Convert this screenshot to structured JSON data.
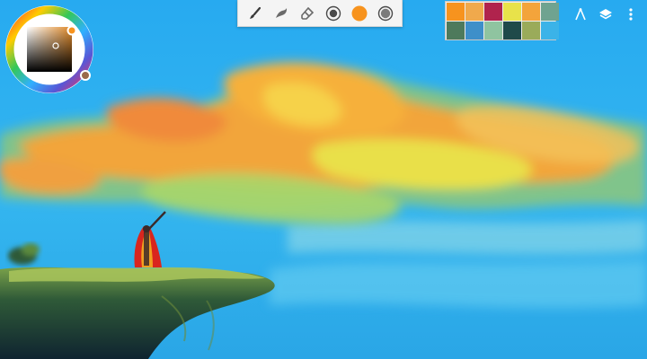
{
  "colors": {
    "toolbar_bg": "#f4f4f4",
    "sky": "#2ab0ef",
    "active_color": "#f7931e",
    "selected_color": "#9a6a4a"
  },
  "toolbar": {
    "tools": [
      {
        "name": "brush-tool",
        "icon": "brush-icon"
      },
      {
        "name": "smudge-tool",
        "icon": "smudge-icon"
      },
      {
        "name": "eraser-tool",
        "icon": "eraser-icon"
      },
      {
        "name": "brush-size-button",
        "icon": "brush-size-icon"
      },
      {
        "name": "current-color-button",
        "icon": "color-dot-icon"
      },
      {
        "name": "opacity-button",
        "icon": "opacity-icon"
      }
    ]
  },
  "palette": {
    "swatches": [
      "#f7931e",
      "#f0a94c",
      "#b0234d",
      "#e8e24a",
      "#f3a43b",
      "#6fa390",
      "#4e7a5c",
      "#3e8fc9",
      "#8fc4a0",
      "#1f4a4a",
      "#9aab5a",
      "#3bb3e8"
    ]
  },
  "top_right": {
    "buttons": [
      {
        "name": "ruler-button",
        "icon": "ruler-icon"
      },
      {
        "name": "layers-button",
        "icon": "layers-icon"
      },
      {
        "name": "more-options-button",
        "icon": "more-vertical-icon"
      }
    ]
  }
}
